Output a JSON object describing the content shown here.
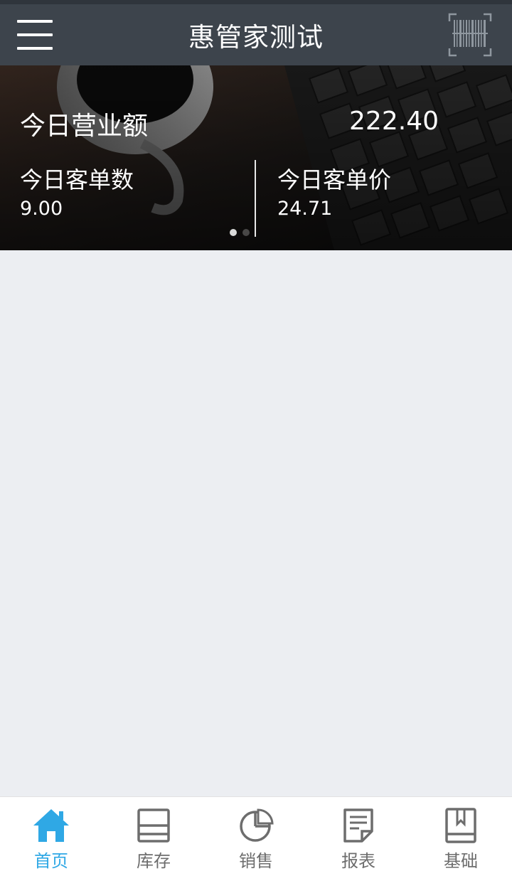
{
  "header": {
    "title": "惠管家测试",
    "menu_icon": "hamburger-menu-icon",
    "scan_icon": "barcode-scan-icon"
  },
  "banner": {
    "revenue_label": "今日营业额",
    "revenue_value": "222.40",
    "orders_label": "今日客单数",
    "orders_value": "9.00",
    "avg_label": "今日客单价",
    "avg_value": "24.71",
    "active_slide": 1,
    "slide_count": 2
  },
  "tabs": [
    {
      "label": "首页",
      "icon": "home-icon",
      "active": true
    },
    {
      "label": "库存",
      "icon": "inventory-icon",
      "active": false
    },
    {
      "label": "销售",
      "icon": "pie-chart-icon",
      "active": false
    },
    {
      "label": "报表",
      "icon": "report-icon",
      "active": false
    },
    {
      "label": "基础",
      "icon": "book-icon",
      "active": false
    }
  ],
  "colors": {
    "app_bar": "#3d444c",
    "accent": "#2fa8e5",
    "inactive_tab": "#6d6d6d",
    "background": "#eceef2"
  }
}
